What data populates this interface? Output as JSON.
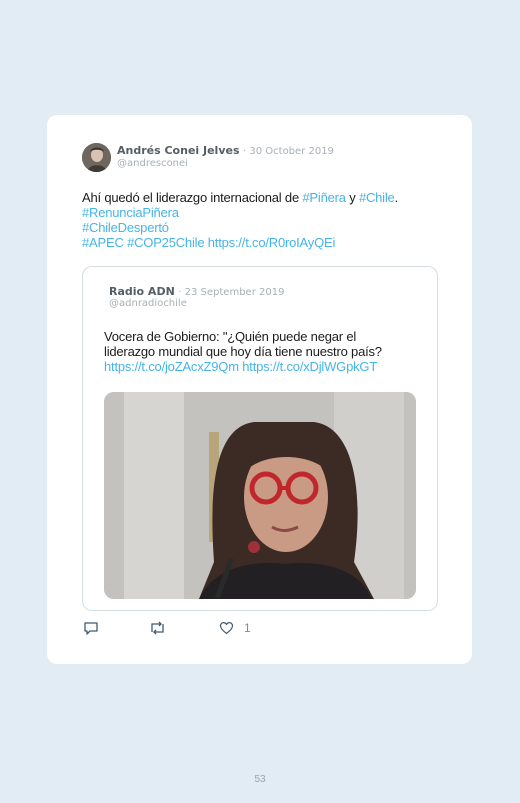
{
  "tweet": {
    "author_name": "Andrés Conei Jelves",
    "date": "· 30 October 2019",
    "handle": "@andresconei",
    "text_lines": [
      [
        {
          "t": "Ahí quedó el liderazgo internacional de ",
          "link": false
        },
        {
          "t": "#Piñera",
          "link": true
        },
        {
          "t": " y ",
          "link": false
        },
        {
          "t": "#Chile",
          "link": true
        },
        {
          "t": ".",
          "link": false
        }
      ],
      [
        {
          "t": "#RenunciaPiñera",
          "link": true
        }
      ],
      [
        {
          "t": "#ChileDespertó",
          "link": true
        }
      ],
      [
        {
          "t": "#APEC",
          "link": true
        },
        {
          "t": " ",
          "link": false
        },
        {
          "t": "#COP25Chile",
          "link": true
        },
        {
          "t": " ",
          "link": false
        },
        {
          "t": "https://t.co/R0roIAyQEi",
          "link": true
        }
      ]
    ],
    "like_count": "1"
  },
  "quoted": {
    "author_name": "Radio ADN",
    "date": "· 23 September 2019",
    "handle": "@adnradiochile",
    "text_lines": [
      [
        {
          "t": "Vocera de Gobierno: \"¿Quién puede negar el",
          "link": false
        }
      ],
      [
        {
          "t": "liderazgo mundial que hoy día tiene nuestro país?",
          "link": false
        }
      ],
      [
        {
          "t": "https://t.co/joZAcxZ9Qm",
          "link": true
        },
        {
          "t": " ",
          "link": false
        },
        {
          "t": "https://t.co/xDjlWGpkGT",
          "link": true
        }
      ]
    ]
  },
  "icons": {
    "reply": "reply-icon",
    "retweet": "retweet-icon",
    "like": "heart-icon"
  },
  "colors": {
    "link": "#46b4e8",
    "background": "#e1ecf4"
  },
  "page_number": "53"
}
